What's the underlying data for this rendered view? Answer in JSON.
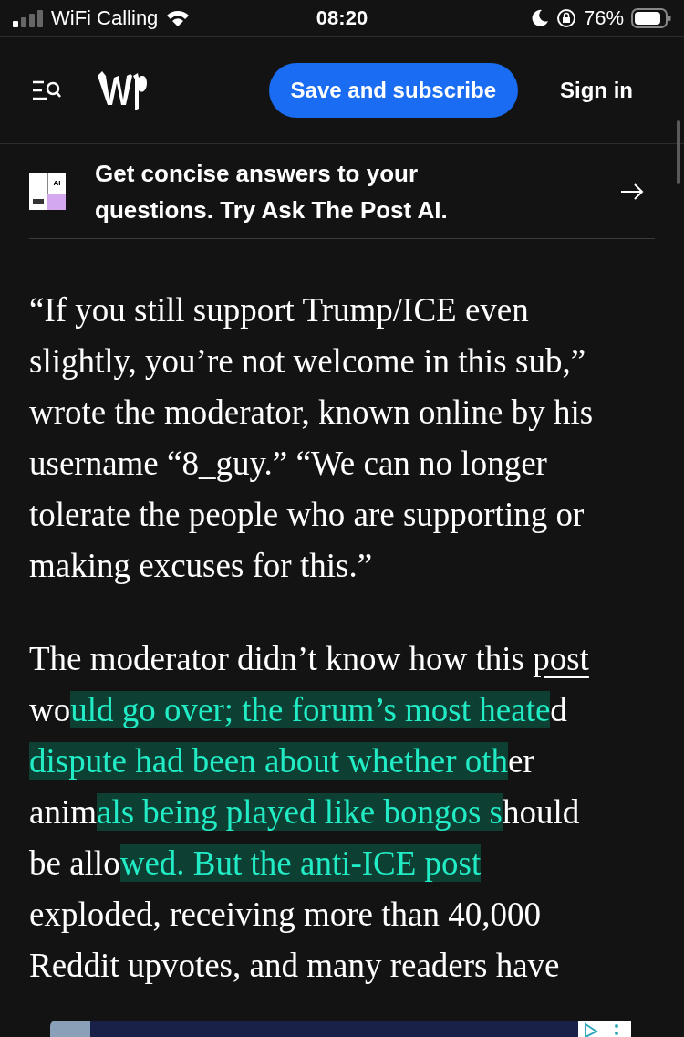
{
  "status_bar": {
    "carrier": "WiFi Calling",
    "time": "08:20",
    "battery": "76%"
  },
  "header": {
    "subscribe_button": "Save and subscribe",
    "sign_in": "Sign in"
  },
  "ai_banner": {
    "icon_label": "AI",
    "text": "Get concise answers to your questions. Try Ask The Post AI."
  },
  "paragraphs": [
    {
      "lines": [
        [
          {
            "kind": "text",
            "text": "“If you still support Trump/ICE even"
          }
        ],
        [
          {
            "kind": "text",
            "text": "slightly, you’re not welcome in this sub,”"
          }
        ],
        [
          {
            "kind": "text",
            "text": "wrote the moderator, known online by his"
          }
        ],
        [
          {
            "kind": "text",
            "text": "username “8_guy.” “We can no longer"
          }
        ],
        [
          {
            "kind": "text",
            "text": "tolerate the people who are supporting or"
          }
        ],
        [
          {
            "kind": "text",
            "text": "making excuses for this.”"
          }
        ]
      ]
    },
    {
      "lines": [
        [
          {
            "kind": "text",
            "text": "The moderator didn’t know how this "
          },
          {
            "kind": "link",
            "text": "post"
          }
        ],
        [
          {
            "kind": "text",
            "text": "wo"
          },
          {
            "kind": "highlight",
            "text": "uld go over; the forum’s most heate"
          },
          {
            "kind": "text",
            "text": "d"
          }
        ],
        [
          {
            "kind": "highlight",
            "text": "dispute had been about whether oth"
          },
          {
            "kind": "text",
            "text": "er"
          }
        ],
        [
          {
            "kind": "text",
            "text": "anim"
          },
          {
            "kind": "highlight",
            "text": "als being played like bongos s"
          },
          {
            "kind": "text",
            "text": "hould"
          }
        ],
        [
          {
            "kind": "text",
            "text": "be allo"
          },
          {
            "kind": "highlight",
            "text": "wed. But the anti-ICE post"
          }
        ],
        [
          {
            "kind": "text",
            "text": "exploded, receiving more than 40,000"
          }
        ],
        [
          {
            "kind": "text",
            "text": "Reddit upvotes, and many readers have"
          }
        ]
      ]
    }
  ]
}
